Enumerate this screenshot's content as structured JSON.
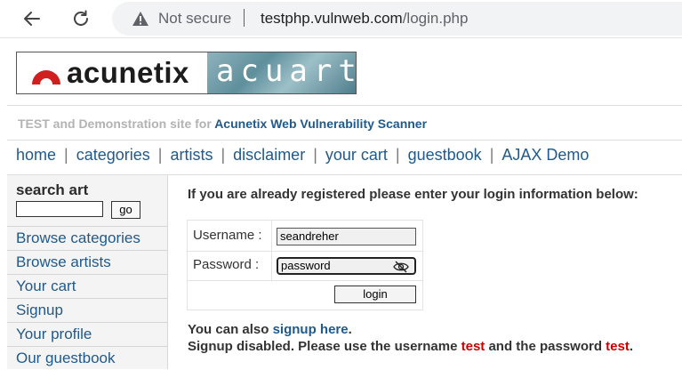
{
  "browser": {
    "security_label": "Not secure",
    "url_host": "testphp.vulnweb.com",
    "url_path": "/login.php"
  },
  "logo": {
    "brand_left": "acunetix",
    "brand_right": "acuart"
  },
  "tagline": {
    "prefix": "TEST and Demonstration site for",
    "highlight": "Acunetix Web Vulnerability Scanner"
  },
  "menu": {
    "items": [
      "home",
      "categories",
      "artists",
      "disclaimer",
      "your cart",
      "guestbook",
      "AJAX Demo"
    ]
  },
  "sidebar": {
    "search_title": "search art",
    "search_value": "",
    "go_label": "go",
    "links": [
      "Browse categories",
      "Browse artists",
      "Your cart",
      "Signup",
      "Your profile",
      "Our guestbook"
    ]
  },
  "login": {
    "heading": "If you are already registered please enter your login information below:",
    "username_label": "Username :",
    "username_value": "seandreher",
    "password_label": "Password :",
    "password_value": "password",
    "button_label": "login"
  },
  "footer": {
    "signup_prefix": "You can also",
    "signup_link": "signup here",
    "signup_suffix": ".",
    "disabled_prefix": "Signup disabled. Please use the username",
    "disabled_username": "test",
    "disabled_middle": "and the password",
    "disabled_password": "test",
    "disabled_suffix": "."
  },
  "colors": {
    "link": "#215a8a",
    "accent_red": "#cc0000",
    "logo_red": "#d11f1f"
  }
}
